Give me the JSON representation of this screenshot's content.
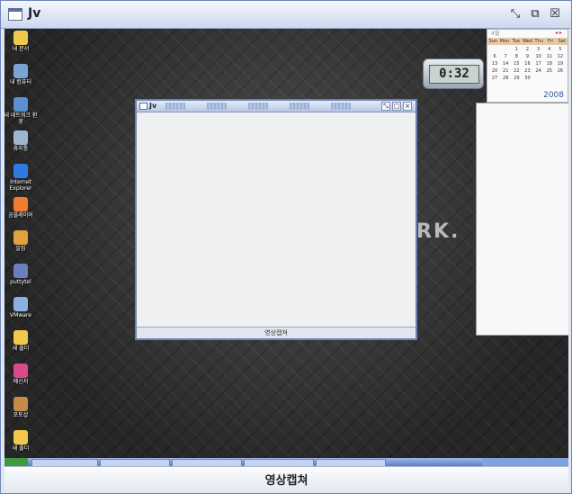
{
  "window": {
    "title": "Jv",
    "minimize_glyph": "⤡",
    "maximize_glyph": "⧉",
    "close_glyph": "☒"
  },
  "desktop": {
    "icons": [
      {
        "label": "내 문서",
        "icon": "folder-icon",
        "color": "#f0c94a"
      },
      {
        "label": "내 컴퓨터",
        "icon": "computer-icon",
        "color": "#7aa4d8"
      },
      {
        "label": "내 네트워크 환경",
        "icon": "network-icon",
        "color": "#5c8fd0"
      },
      {
        "label": "휴지통",
        "icon": "recycle-bin-icon",
        "color": "#9fb6cf"
      },
      {
        "label": "Internet Explorer",
        "icon": "internet-explorer-icon",
        "color": "#2d7be0"
      },
      {
        "label": "곰플레이어",
        "icon": "media-player-icon",
        "color": "#f07d2b"
      },
      {
        "label": "알집",
        "icon": "archive-icon",
        "color": "#e0a23c"
      },
      {
        "label": "puttytel",
        "icon": "terminal-icon",
        "color": "#6a7fc0"
      },
      {
        "label": "VMware",
        "icon": "vmware-icon",
        "color": "#8db0e0"
      },
      {
        "label": "새 폴더",
        "icon": "folder-icon",
        "color": "#f0c94a"
      },
      {
        "label": "메신저",
        "icon": "messenger-icon",
        "color": "#d84a8a"
      },
      {
        "label": "포토샵",
        "icon": "photo-icon",
        "color": "#c58a4a"
      },
      {
        "label": "새 폴더",
        "icon": "folder-icon",
        "color": "#f0c94a"
      }
    ],
    "watermark": "RK."
  },
  "clock": {
    "time": "0:32"
  },
  "calendar": {
    "month_label": "4월",
    "weekdays": [
      "Sun",
      "Mon",
      "Tue",
      "Wed",
      "Thu",
      "Fri",
      "Sat"
    ],
    "days": [
      "",
      "",
      "1",
      "2",
      "3",
      "4",
      "5",
      "6",
      "7",
      "8",
      "9",
      "10",
      "11",
      "12",
      "13",
      "14",
      "15",
      "16",
      "17",
      "18",
      "19",
      "20",
      "21",
      "22",
      "23",
      "24",
      "25",
      "26",
      "27",
      "28",
      "29",
      "30",
      "",
      "",
      ""
    ],
    "year": "2008"
  },
  "memo": {
    "header": "",
    "lines": [
      {
        "text": "",
        "style": "red"
      },
      {
        "text": "",
        "style": "gap"
      },
      {
        "text": "",
        "style": "red"
      },
      {
        "text": "",
        "style": "normal"
      },
      {
        "text": "",
        "style": "normal"
      },
      {
        "text": "",
        "style": "gap"
      },
      {
        "text": "",
        "style": "red"
      },
      {
        "text": "",
        "style": "gap"
      },
      {
        "text": "",
        "style": "red"
      },
      {
        "text": "",
        "style": "normal"
      },
      {
        "text": "",
        "style": "gap"
      },
      {
        "text": "",
        "style": "normal"
      },
      {
        "text": "",
        "style": "normal"
      },
      {
        "text": "",
        "style": "normal"
      },
      {
        "text": "",
        "style": "normal"
      },
      {
        "text": "",
        "style": "gap"
      },
      {
        "text": "",
        "style": "normal"
      },
      {
        "text": "",
        "style": "normal"
      },
      {
        "text": "",
        "style": "normal"
      },
      {
        "text": "",
        "style": "gap"
      },
      {
        "text": "",
        "style": "normal"
      },
      {
        "text": "",
        "style": "normal"
      },
      {
        "text": "",
        "style": "normal"
      }
    ]
  },
  "inner_window": {
    "title": "Jv",
    "status_text": "영상캡쳐"
  },
  "bottom": {
    "capture_button_label": "영상캡쳐"
  }
}
